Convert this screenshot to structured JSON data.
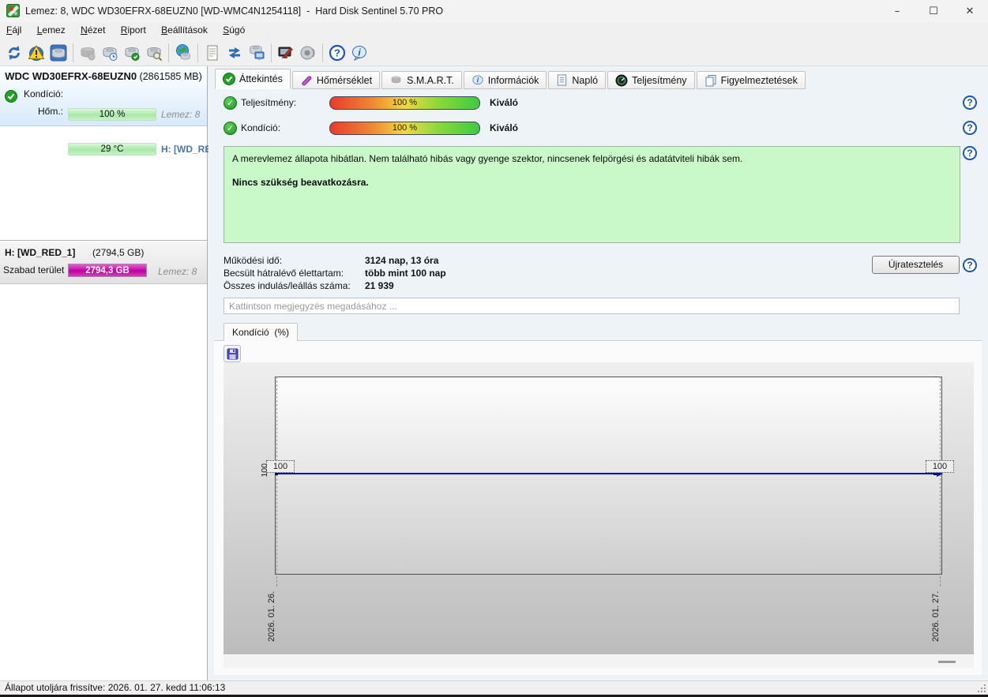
{
  "window": {
    "title": "Lemez: 8, WDC WD30EFRX-68EUZN0 [WD-WMC4N1254118]  -  Hard Disk Sentinel 5.70 PRO",
    "controls": {
      "minimize": "–",
      "maximize": "☐",
      "close": "✕"
    }
  },
  "menu": {
    "items": [
      {
        "label": "Fájl"
      },
      {
        "label": "Lemez"
      },
      {
        "label": "Nézet"
      },
      {
        "label": "Riport"
      },
      {
        "label": "Beállítások"
      },
      {
        "label": "Súgó"
      }
    ]
  },
  "toolbar": {
    "icons": [
      "refresh-icon",
      "disk-warning-icon",
      "disk-view-icon",
      "disk-disabled-icon",
      "disk-clock-icon",
      "disk-ok-icon",
      "disk-search-icon",
      "network-globe-icon",
      "report-icon",
      "mail-sync-icon",
      "remote-disk-icon",
      "surface-test-icon",
      "sound-icon",
      "help-icon",
      "info-icon"
    ]
  },
  "sidebar": {
    "disk": {
      "name": "WDC WD30EFRX-68EUZN0",
      "size": "(2861585 MB)",
      "condition_label": "Kondíció:",
      "condition_value": "100 %",
      "disk_ref": "Lemez: 8",
      "temp_label": "Hőm.:",
      "temp_value": "29 °C",
      "volume_ref": "H: [WD_RED_"
    },
    "partition": {
      "name": "H: [WD_RED_1]",
      "size": "(2794,5 GB)",
      "free_label": "Szabad terület",
      "free_value": "2794,3 GB",
      "disk_ref": "Lemez: 8"
    }
  },
  "tabs": [
    {
      "label": "Áttekintés"
    },
    {
      "label": "Hőmérséklet"
    },
    {
      "label": "S.M.A.R.T."
    },
    {
      "label": "Információk"
    },
    {
      "label": "Napló"
    },
    {
      "label": "Teljesítmény"
    },
    {
      "label": "Figyelmeztetések"
    }
  ],
  "overview": {
    "performance": {
      "label": "Teljesítmény:",
      "value": "100 %",
      "rating": "Kiváló"
    },
    "condition": {
      "label": "Kondíció:",
      "value": "100 %",
      "rating": "Kiváló"
    },
    "health_text": "A merevlemez állapota hibátlan. Nem található hibás vagy gyenge szektor, nincsenek felpörgési és adatátviteli hibák sem.",
    "health_action": "Nincs szükség beavatkozásra.",
    "stats": [
      {
        "label": "Működési idő:",
        "value": "3124 nap, 13 óra"
      },
      {
        "label": "Becsült hátralévő élettartam:",
        "value": "több mint 100 nap"
      },
      {
        "label": "Összes indulás/leállás száma:",
        "value": "21 939"
      }
    ],
    "retest_button": "Újratesztelés",
    "comment_placeholder": "Kattintson megjegyzés megadásához ..."
  },
  "chart": {
    "tab_label": "Kondíció  (%)",
    "axis_label": "100",
    "left_point_label": "100",
    "right_point_label": "100",
    "left_date": "2026. 01. 26.",
    "right_date": "2026. 01. 27."
  },
  "chart_data": {
    "type": "line",
    "title": "Kondíció (%)",
    "x": [
      "2026. 01. 26.",
      "2026. 01. 27."
    ],
    "values": [
      100,
      100
    ],
    "ylabel": "Kondíció (%)",
    "point_labels": [
      "100",
      "100"
    ],
    "line_color": "#0008ae",
    "grid": "dashed-vertical-at-points",
    "legend": "none"
  },
  "status_bar": {
    "text": "Állapot utoljára frissítve: 2026. 01. 27. kedd 11:06:13"
  },
  "colors": {
    "health_box": "#c9f8c9",
    "free_space_bar": "#bf00a0",
    "condition_bar": "#a6e8a6",
    "accent_blue": "#1c56b0",
    "chart_line": "#0008ae"
  }
}
